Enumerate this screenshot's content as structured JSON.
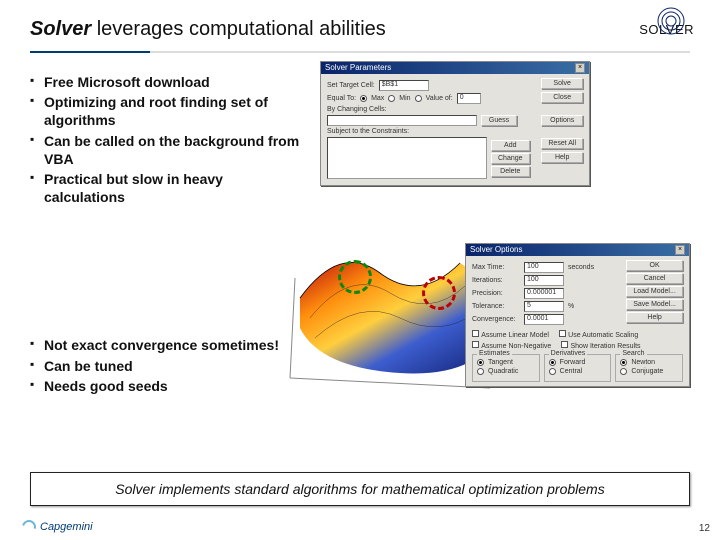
{
  "header": {
    "title_bold": "Solver",
    "title_rest": " leverages computational abilities",
    "brand": "SOLVER"
  },
  "bullets_top": [
    "Free Microsoft download",
    "Optimizing and root finding set of algorithms",
    "Can be called on the background from VBA",
    "Practical but slow in heavy calculations"
  ],
  "bullets_bottom": [
    "Not exact convergence sometimes!",
    "Can be tuned",
    "Needs good seeds"
  ],
  "dialog_params": {
    "title": "Solver Parameters",
    "set_target": "Set Target Cell:",
    "target_value": "$B$1",
    "equal_to": "Equal To:",
    "opt_max": "Max",
    "opt_min": "Min",
    "opt_value": "Value of:",
    "zero": "0",
    "by_changing": "By Changing Cells:",
    "subject": "Subject to the Constraints:",
    "btn_solve": "Solve",
    "btn_close": "Close",
    "btn_guess": "Guess",
    "btn_options": "Options",
    "btn_add": "Add",
    "btn_change": "Change",
    "btn_reset": "Reset All",
    "btn_delete": "Delete",
    "btn_help": "Help"
  },
  "dialog_options": {
    "title": "Solver Options",
    "max_time": "Max Time:",
    "max_time_v": "100",
    "seconds": "seconds",
    "iterations": "Iterations:",
    "iterations_v": "100",
    "precision": "Precision:",
    "precision_v": "0.000001",
    "tolerance": "Tolerance:",
    "tolerance_v": "5",
    "percent": "%",
    "convergence": "Convergence:",
    "convergence_v": "0.0001",
    "assume_linear": "Assume Linear Model",
    "assume_nonneg": "Assume Non-Negative",
    "auto_scaling": "Use Automatic Scaling",
    "show_iter": "Show Iteration Results",
    "estimates": "Estimates",
    "est_tangent": "Tangent",
    "est_quadratic": "Quadratic",
    "derivatives": "Derivatives",
    "der_forward": "Forward",
    "der_central": "Central",
    "search": "Search",
    "s_newton": "Newton",
    "s_conjugate": "Conjugate",
    "btn_ok": "OK",
    "btn_cancel": "Cancel",
    "btn_load": "Load Model...",
    "btn_save": "Save Model...",
    "btn_help": "Help"
  },
  "summary": "Solver implements standard algorithms for mathematical optimization problems",
  "footer_brand": "Capgemini",
  "page": "12"
}
